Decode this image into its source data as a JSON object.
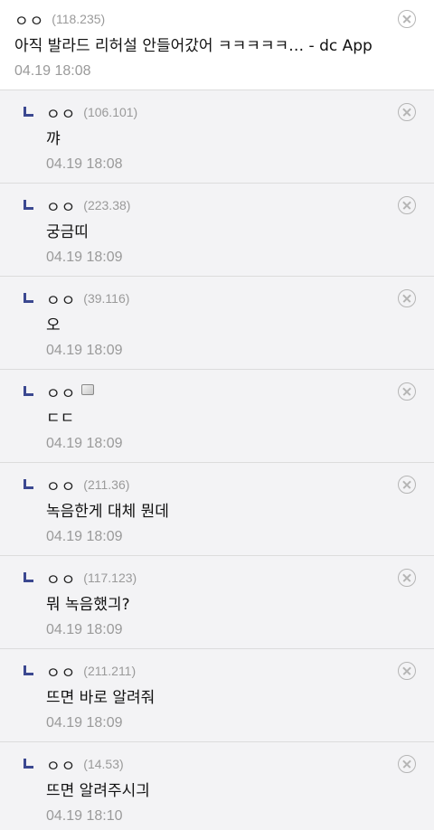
{
  "comments": [
    {
      "nick": "ㅇㅇ",
      "ip": "(118.235)",
      "text": "아직 발라드 리허설 안들어갔어 ㅋㅋㅋㅋㅋ… - dc App",
      "date": "04.19 18:08"
    },
    {
      "nick": "ㅇㅇ",
      "ip": "(106.101)",
      "text": "꺄",
      "date": "04.19 18:08"
    },
    {
      "nick": "ㅇㅇ",
      "ip": "(223.38)",
      "text": "궁금띠",
      "date": "04.19 18:09"
    },
    {
      "nick": "ㅇㅇ",
      "ip": "(39.116)",
      "text": "오",
      "date": "04.19 18:09"
    },
    {
      "nick": "ㅇㅇ",
      "ip": "",
      "text": "ㄷㄷ",
      "date": "04.19 18:09"
    },
    {
      "nick": "ㅇㅇ",
      "ip": "(211.36)",
      "text": "녹음한게 대체 뭔데",
      "date": "04.19 18:09"
    },
    {
      "nick": "ㅇㅇ",
      "ip": "(117.123)",
      "text": "뭐 녹음했긔?",
      "date": "04.19 18:09"
    },
    {
      "nick": "ㅇㅇ",
      "ip": "(211.211)",
      "text": "뜨면 바로 알려줘",
      "date": "04.19 18:09"
    },
    {
      "nick": "ㅇㅇ",
      "ip": "(14.53)",
      "text": "뜨면 알려주시긔",
      "date": "04.19 18:10"
    }
  ],
  "icons": {
    "delete": "close-circle-icon",
    "reply": "reply-arrow-icon",
    "fixed_nick": "fixed-nick-icon"
  },
  "colors": {
    "reply_mark": "#3b4890",
    "reply_bg": "#f3f3f5",
    "meta_gray": "#9a9a9a"
  }
}
